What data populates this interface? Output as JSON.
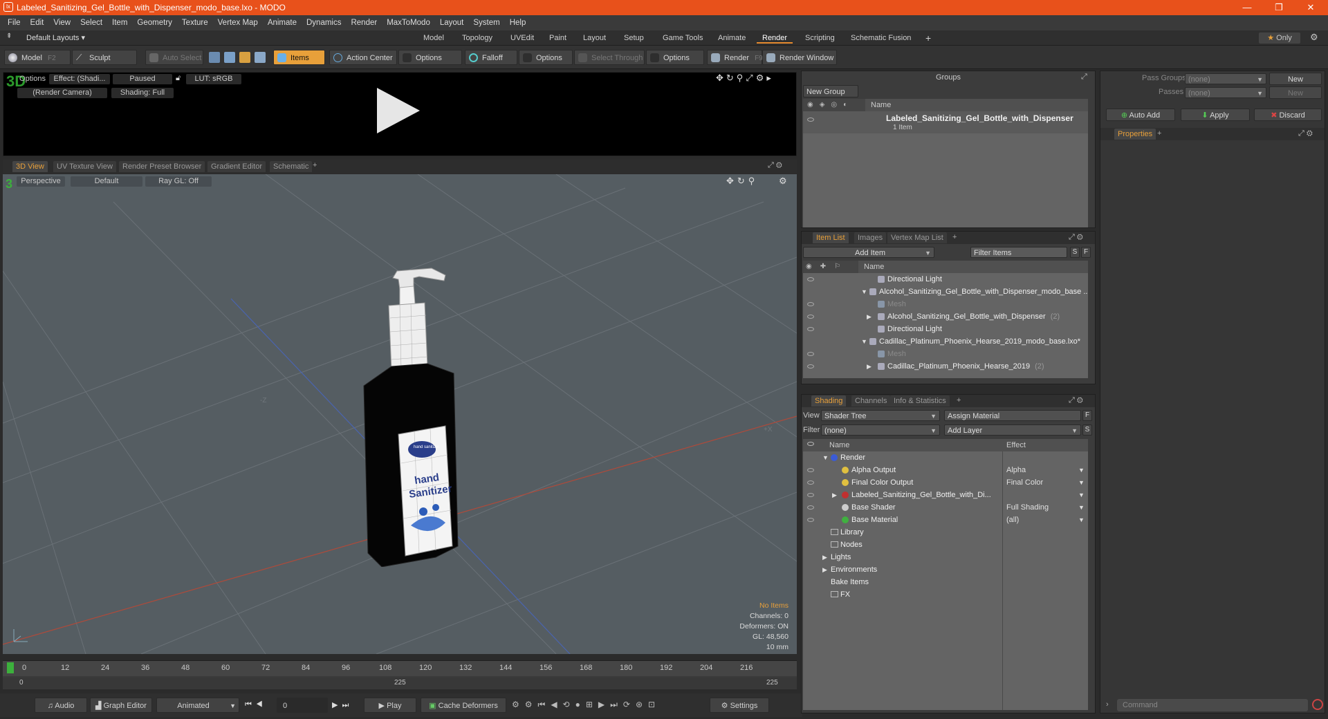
{
  "window": {
    "title": "Labeled_Sanitizing_Gel_Bottle_with_Dispenser_modo_base.lxo - MODO",
    "minimize": "—",
    "maximize": "❐",
    "close": "✕"
  },
  "menu": [
    "File",
    "Edit",
    "View",
    "Select",
    "Item",
    "Geometry",
    "Texture",
    "Vertex Map",
    "Animate",
    "Dynamics",
    "Render",
    "MaxToModo",
    "Layout",
    "System",
    "Help"
  ],
  "layout_tabs": {
    "default_layouts": "Default Layouts",
    "tabs": [
      "Model",
      "Topology",
      "UVEdit",
      "Paint",
      "Layout",
      "Setup",
      "Game Tools",
      "Animate",
      "Render",
      "Scripting",
      "Schematic Fusion"
    ],
    "active": "Render",
    "add": "+",
    "only": "Only"
  },
  "toolbar": {
    "model": "Model",
    "model_key": "F2",
    "sculpt": "Sculpt",
    "auto_select": "Auto Select",
    "items": "Items",
    "action_center": "Action Center",
    "options1": "Options",
    "falloff": "Falloff",
    "options2": "Options",
    "select_through": "Select Through",
    "options3": "Options",
    "render": "Render",
    "render_key": "F9",
    "render_window": "Render Window"
  },
  "render_view": {
    "options": "Options",
    "effect": "Effect: (Shadi...",
    "paused": "Paused",
    "lut": "LUT: sRGB",
    "camera": "(Render Camera)",
    "shading": "Shading: Full"
  },
  "viewport_tabs": [
    "3D View",
    "UV Texture View",
    "Render Preset Browser",
    "Gradient Editor",
    "Schematic"
  ],
  "viewport": {
    "perspective": "Perspective",
    "default": "Default",
    "raygl": "Ray GL: Off",
    "axis_z": "-Z",
    "axis_x": "+X",
    "label_hand": "hand",
    "label_sanitizer": "Sanitizer",
    "label_top": "hand sanitizer",
    "stats": {
      "no_items": "No Items",
      "channels": "Channels: 0",
      "deformers": "Deformers: ON",
      "gl": "GL: 48,560",
      "scale": "10 mm"
    }
  },
  "timeline": {
    "ticks": [
      "0",
      "12",
      "24",
      "36",
      "48",
      "60",
      "72",
      "84",
      "96",
      "108",
      "120",
      "132",
      "144",
      "156",
      "168",
      "180",
      "192",
      "204",
      "216"
    ],
    "start": "0",
    "mid": "225",
    "end": "225"
  },
  "bottombar": {
    "audio": "Audio",
    "graph_editor": "Graph Editor",
    "animated": "Animated",
    "frame": "0",
    "play": "Play",
    "cache_deformers": "Cache Deformers",
    "settings": "Settings"
  },
  "groups": {
    "title": "Groups",
    "new_group": "New Group",
    "col_name": "Name",
    "item_name": "Labeled_Sanitizing_Gel_Bottle_with_Dispenser",
    "item_sub": "1 Item"
  },
  "pass_groups": {
    "pass_groups_label": "Pass Groups",
    "passes_label": "Passes",
    "none1": "(none)",
    "none2": "(none)",
    "new1": "New",
    "new2": "New",
    "auto_add": "Auto Add",
    "apply": "Apply",
    "discard": "Discard",
    "properties": "Properties"
  },
  "item_list": {
    "tabs": [
      "Item List",
      "Images",
      "Vertex Map List"
    ],
    "add_item": "Add Item",
    "filter": "Filter Items",
    "s": "S",
    "f": "F",
    "col_name": "Name",
    "rows": [
      {
        "label": "Directional Light",
        "indent": 2,
        "dim": false,
        "suffix": ""
      },
      {
        "label": "Alcohol_Sanitizing_Gel_Bottle_with_Dispenser_modo_base ...",
        "indent": 0,
        "dim": false,
        "suffix": ""
      },
      {
        "label": "Mesh",
        "indent": 2,
        "dim": true,
        "suffix": ""
      },
      {
        "label": "Alcohol_Sanitizing_Gel_Bottle_with_Dispenser",
        "indent": 2,
        "dim": false,
        "suffix": "(2)"
      },
      {
        "label": "Directional Light",
        "indent": 2,
        "dim": false,
        "suffix": ""
      },
      {
        "label": "Cadillac_Platinum_Phoenix_Hearse_2019_modo_base.lxo*",
        "indent": 0,
        "dim": false,
        "suffix": ""
      },
      {
        "label": "Mesh",
        "indent": 2,
        "dim": true,
        "suffix": ""
      },
      {
        "label": "Cadillac_Platinum_Phoenix_Hearse_2019",
        "indent": 2,
        "dim": false,
        "suffix": "(2)"
      }
    ]
  },
  "shading": {
    "tabs": [
      "Shading",
      "Channels",
      "Info & Statistics"
    ],
    "view_label": "View",
    "view_value": "Shader Tree",
    "assign_material": "Assign Material",
    "filter_label": "Filter",
    "filter_value": "(none)",
    "add_layer": "Add Layer",
    "f": "F",
    "s": "S",
    "col_name": "Name",
    "col_effect": "Effect",
    "rows": [
      {
        "label": "Render",
        "effect": "",
        "indent": 0,
        "color": "#3b5bd6"
      },
      {
        "label": "Alpha Output",
        "effect": "Alpha",
        "indent": 1,
        "color": "#e0c040"
      },
      {
        "label": "Final Color Output",
        "effect": "Final Color",
        "indent": 1,
        "color": "#e0c040"
      },
      {
        "label": "Labeled_Sanitizing_Gel_Bottle_with_Di...",
        "effect": "",
        "indent": 1,
        "color": "#c03030"
      },
      {
        "label": "Base Shader",
        "effect": "Full Shading",
        "indent": 1,
        "color": "#cccccc"
      },
      {
        "label": "Base Material",
        "effect": "(all)",
        "indent": 1,
        "color": "#40b040"
      },
      {
        "label": "Library",
        "effect": "",
        "indent": 0,
        "color": ""
      },
      {
        "label": "Nodes",
        "effect": "",
        "indent": 0,
        "color": ""
      },
      {
        "label": "Lights",
        "effect": "",
        "indent": 0,
        "color": ""
      },
      {
        "label": "Environments",
        "effect": "",
        "indent": 0,
        "color": ""
      },
      {
        "label": "Bake Items",
        "effect": "",
        "indent": 0,
        "color": ""
      },
      {
        "label": "FX",
        "effect": "",
        "indent": 0,
        "color": ""
      }
    ]
  },
  "command": {
    "placeholder": "Command"
  },
  "colors": {
    "accent": "#e8a03a",
    "titlebar": "#e8511b"
  }
}
